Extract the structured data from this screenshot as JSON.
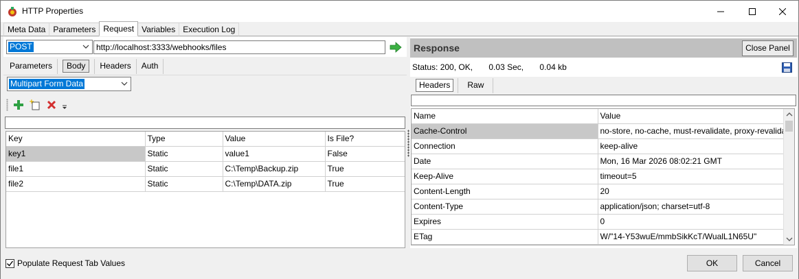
{
  "window": {
    "title": "HTTP Properties"
  },
  "top_tabs": [
    "Meta Data",
    "Parameters",
    "Request",
    "Variables",
    "Execution Log"
  ],
  "request": {
    "method": "POST",
    "url": "http://localhost:3333/webhooks/files",
    "sub_tabs": [
      "Parameters",
      "Body",
      "Headers",
      "Auth"
    ],
    "body_type": "Multipart Form Data",
    "grid": {
      "columns": [
        "Key",
        "Type",
        "Value",
        "Is File?"
      ],
      "rows": [
        [
          "key1",
          "Static",
          "value1",
          "False"
        ],
        [
          "file1",
          "Static",
          "C:\\Temp\\Backup.zip",
          "True"
        ],
        [
          "file2",
          "Static",
          "C:\\Temp\\DATA.zip",
          "True"
        ]
      ]
    }
  },
  "response": {
    "title": "Response",
    "close_label": "Close Panel",
    "status": "Status: 200, OK,       0.03 Sec,       0.04 kb",
    "tabs": [
      "Headers",
      "Raw"
    ],
    "grid": {
      "columns": [
        "Name",
        "Value"
      ],
      "rows": [
        [
          "Cache-Control",
          "no-store, no-cache, must-revalidate, proxy-revalidate"
        ],
        [
          "Connection",
          "keep-alive"
        ],
        [
          "Date",
          "Mon, 16 Mar 2026 08:02:21 GMT"
        ],
        [
          "Keep-Alive",
          "timeout=5"
        ],
        [
          "Content-Length",
          "20"
        ],
        [
          "Content-Type",
          "application/json; charset=utf-8"
        ],
        [
          "Expires",
          "0"
        ],
        [
          "ETag",
          "W/\"14-Y53wuE/mmbSikKcT/WualL1N65U\""
        ]
      ]
    }
  },
  "footer": {
    "populate_label": "Populate Request Tab Values",
    "populate_checked": true,
    "ok_label": "OK",
    "cancel_label": "Cancel"
  },
  "colors": {
    "selection": "#0078d7",
    "row_selected": "#c8c8c8",
    "response_header": "#c0c0c0"
  }
}
